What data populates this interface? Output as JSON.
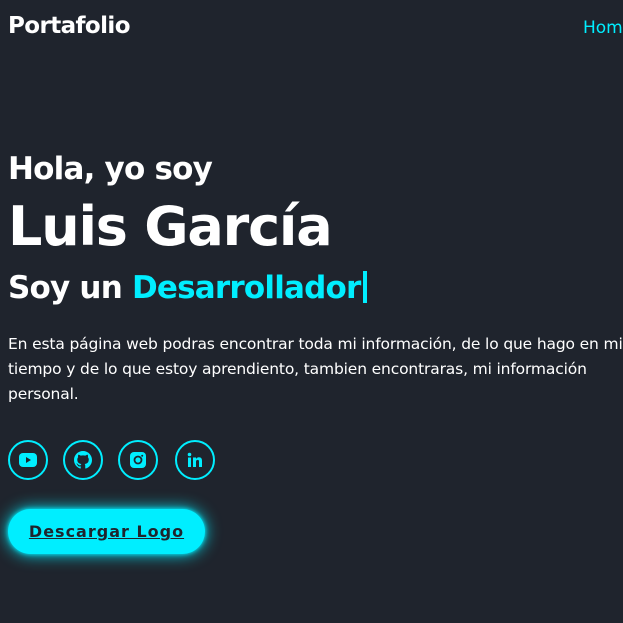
{
  "header": {
    "logo": "Portafolio",
    "nav_items": [
      "Hom"
    ]
  },
  "hero": {
    "greeting": "Hola, yo soy",
    "name": "Luis García",
    "role_prefix": "Soy un ",
    "role_highlight": "Desarrollador",
    "description": "En esta página web podras encontrar toda mi información, de lo que hago en mi tiempo y de lo que estoy aprendiento, tambien encontraras, mi información personal."
  },
  "social": [
    {
      "icon": "youtube-icon"
    },
    {
      "icon": "github-icon"
    },
    {
      "icon": "instagram-icon"
    },
    {
      "icon": "linkedin-icon"
    }
  ],
  "cta": {
    "label": "Descargar Logo"
  },
  "colors": {
    "background": "#1f242d",
    "accent": "#00eeff",
    "text": "#ffffff"
  }
}
